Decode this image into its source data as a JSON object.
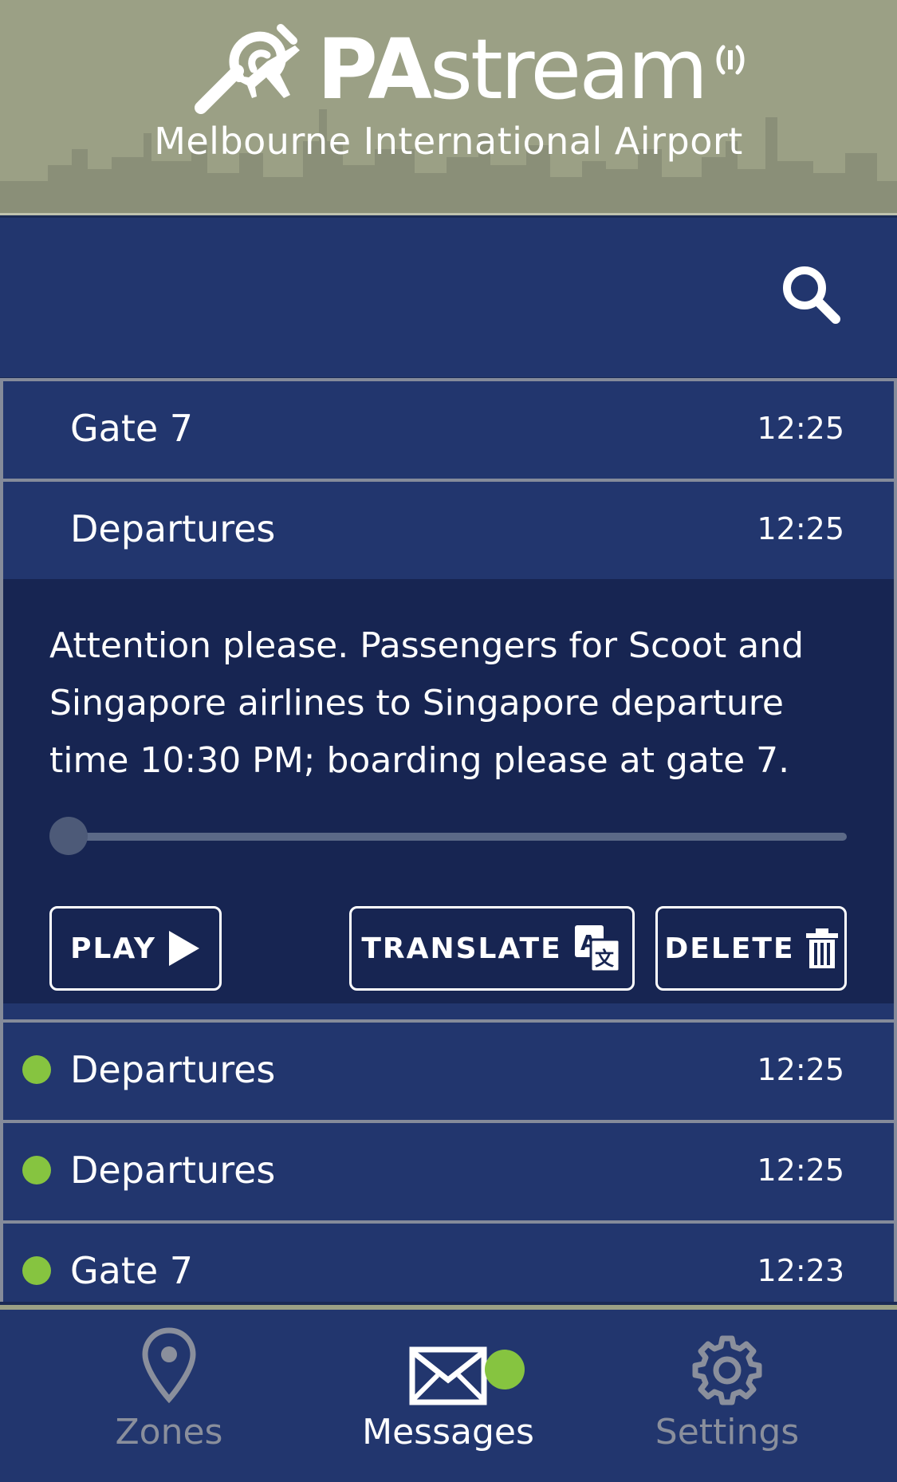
{
  "header": {
    "brand_bold": "PA",
    "brand_light": "stream",
    "airport": "Melbourne International Airport"
  },
  "search": {
    "icon": "search-icon"
  },
  "messages": [
    {
      "title": "Gate 7",
      "time": "12:25",
      "unread": false
    },
    {
      "title": "Departures",
      "time": "12:25",
      "unread": false,
      "expanded": true,
      "body": "Attention please. Passengers for Scoot and Singapore airlines to Singapore departure time 10:30 PM; boarding please at gate 7.",
      "progress": 0
    },
    {
      "title": "Departures",
      "time": "12:25",
      "unread": true
    },
    {
      "title": "Departures",
      "time": "12:25",
      "unread": true
    },
    {
      "title": "Gate 7",
      "time": "12:23",
      "unread": true
    }
  ],
  "actions": {
    "play": "PLAY",
    "translate": "TRANSLATE",
    "delete": "DELETE"
  },
  "nav": {
    "zones": "Zones",
    "messages": "Messages",
    "settings": "Settings",
    "active": "messages"
  },
  "colors": {
    "header_bg": "#9ba085",
    "panel_bg": "#22366e",
    "expanded_bg": "#172552",
    "unread_dot": "#86c440",
    "inactive_nav": "#8a8f9c"
  }
}
